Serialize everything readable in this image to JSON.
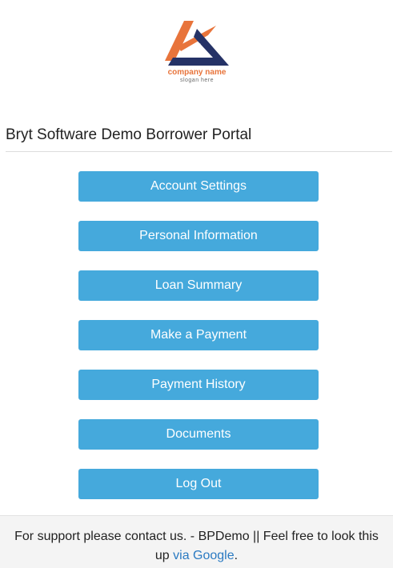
{
  "logo": {
    "name": "company name",
    "slogan": "slogan here",
    "colors": {
      "orange": "#e8743b",
      "navy": "#253266"
    }
  },
  "page": {
    "title": "Bryt Software Demo Borrower Portal"
  },
  "menu": {
    "button_color": "#45a9dc",
    "items": [
      {
        "label": "Account Settings"
      },
      {
        "label": "Personal Information"
      },
      {
        "label": "Loan Summary"
      },
      {
        "label": "Make a Payment"
      },
      {
        "label": "Payment History"
      },
      {
        "label": "Documents"
      },
      {
        "label": "Log Out"
      }
    ]
  },
  "footer": {
    "text_before": "For support please contact us. - BPDemo || Feel free to look this up ",
    "link_text": "via Google",
    "text_after": "."
  }
}
